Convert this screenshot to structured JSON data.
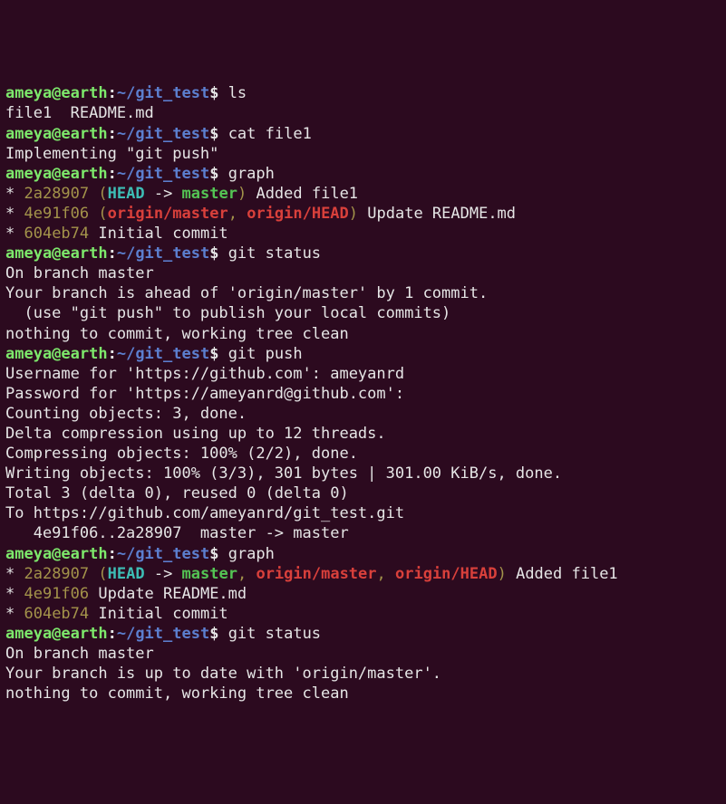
{
  "prompt": {
    "user": "ameya@earth",
    "sep": ":",
    "path": "~/git_test",
    "sigil": "$"
  },
  "blocks": [
    {
      "type": "prompt",
      "cmd": "ls"
    },
    {
      "type": "out",
      "text": "file1  README.md"
    },
    {
      "type": "prompt",
      "cmd": "cat file1"
    },
    {
      "type": "out",
      "text": "Implementing \"git push\""
    },
    {
      "type": "prompt",
      "cmd": "graph"
    },
    {
      "type": "graph",
      "hash": "2a28907",
      "refs": [
        [
          "head",
          "HEAD"
        ],
        [
          "arrow",
          " -> "
        ],
        [
          "branch",
          "master"
        ]
      ],
      "msg": "Added file1"
    },
    {
      "type": "graph",
      "hash": "4e91f06",
      "refs": [
        [
          "remote",
          "origin/master"
        ],
        [
          "sep",
          ", "
        ],
        [
          "remote",
          "origin/HEAD"
        ]
      ],
      "msg": "Update README.md"
    },
    {
      "type": "graph",
      "hash": "604eb74",
      "refs": null,
      "msg": "Initial commit"
    },
    {
      "type": "prompt",
      "cmd": "git status"
    },
    {
      "type": "out",
      "text": "On branch master"
    },
    {
      "type": "out",
      "text": "Your branch is ahead of 'origin/master' by 1 commit."
    },
    {
      "type": "out",
      "text": "  (use \"git push\" to publish your local commits)"
    },
    {
      "type": "out",
      "text": ""
    },
    {
      "type": "out",
      "text": "nothing to commit, working tree clean"
    },
    {
      "type": "prompt",
      "cmd": "git push"
    },
    {
      "type": "out",
      "text": "Username for 'https://github.com': ameyanrd"
    },
    {
      "type": "out",
      "text": "Password for 'https://ameyanrd@github.com': "
    },
    {
      "type": "out",
      "text": "Counting objects: 3, done."
    },
    {
      "type": "out",
      "text": "Delta compression using up to 12 threads."
    },
    {
      "type": "out",
      "text": "Compressing objects: 100% (2/2), done."
    },
    {
      "type": "out",
      "text": "Writing objects: 100% (3/3), 301 bytes | 301.00 KiB/s, done."
    },
    {
      "type": "out",
      "text": "Total 3 (delta 0), reused 0 (delta 0)"
    },
    {
      "type": "out",
      "text": "To https://github.com/ameyanrd/git_test.git"
    },
    {
      "type": "out",
      "text": "   4e91f06..2a28907  master -> master"
    },
    {
      "type": "prompt",
      "cmd": "graph"
    },
    {
      "type": "graph",
      "hash": "2a28907",
      "refs": [
        [
          "head",
          "HEAD"
        ],
        [
          "arrow",
          " -> "
        ],
        [
          "branch",
          "master"
        ],
        [
          "sep",
          ", "
        ],
        [
          "remote",
          "origin/master"
        ],
        [
          "sep",
          ", "
        ],
        [
          "remote",
          "origin/HEAD"
        ]
      ],
      "msg": "Added file1"
    },
    {
      "type": "graph",
      "hash": "4e91f06",
      "refs": null,
      "msg": "Update README.md"
    },
    {
      "type": "graph",
      "hash": "604eb74",
      "refs": null,
      "msg": "Initial commit"
    },
    {
      "type": "prompt",
      "cmd": "git status"
    },
    {
      "type": "out",
      "text": "On branch master"
    },
    {
      "type": "out",
      "text": "Your branch is up to date with 'origin/master'."
    },
    {
      "type": "out",
      "text": ""
    },
    {
      "type": "out",
      "text": "nothing to commit, working tree clean"
    }
  ]
}
